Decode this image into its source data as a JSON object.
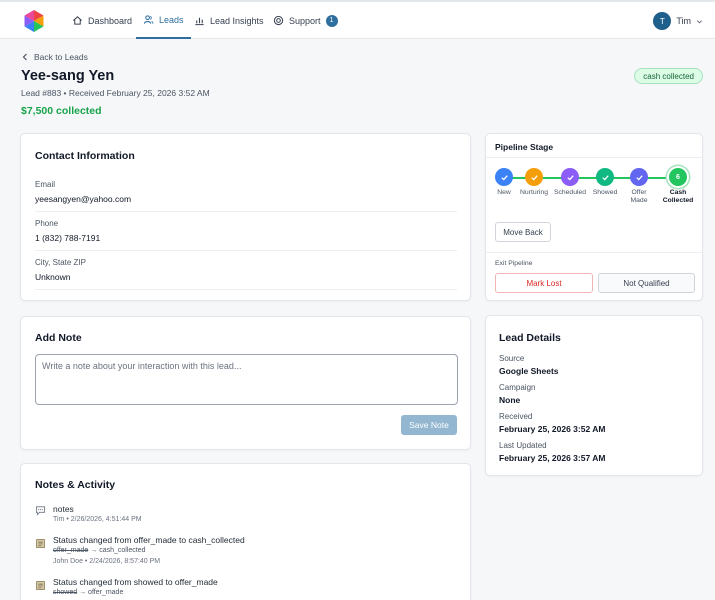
{
  "nav": {
    "items": [
      {
        "label": "Dashboard",
        "icon": "home-icon"
      },
      {
        "label": "Leads",
        "icon": "users-icon"
      },
      {
        "label": "Lead Insights",
        "icon": "chart-icon"
      },
      {
        "label": "Support",
        "icon": "support-icon",
        "badge": "1"
      }
    ],
    "active": "Leads",
    "user": {
      "initial": "T",
      "name": "Tim"
    }
  },
  "header": {
    "back_label": "Back to Leads",
    "name": "Yee-sang Yen",
    "meta": "Lead #883 • Received February 25, 2026 3:52 AM",
    "collected": "$7,500 collected",
    "status": "cash collected"
  },
  "contact": {
    "title": "Contact Information",
    "fields": [
      {
        "label": "Email",
        "value": "yeesangyen@yahoo.com"
      },
      {
        "label": "Phone",
        "value": "1 (832) 788-7191"
      },
      {
        "label": "City, State ZIP",
        "value": "Unknown"
      }
    ]
  },
  "note": {
    "title": "Add Note",
    "placeholder": "Write a note about your interaction with this lead...",
    "value": "",
    "save_label": "Save Note"
  },
  "activity": {
    "title": "Notes & Activity",
    "items": [
      {
        "icon": "comment-icon",
        "text": "notes",
        "by": "Tim • 2/26/2026, 4:51:44 PM"
      },
      {
        "icon": "note-icon",
        "text": "Status changed from offer_made to cash_collected",
        "old": "offer_made",
        "arrow": "→",
        "new": "cash_collected",
        "by": "John Doe • 2/24/2026, 8:57:40 PM"
      },
      {
        "icon": "note-icon",
        "text": "Status changed from showed to offer_made",
        "old": "showed",
        "arrow": "→",
        "new": "offer_made",
        "by": ""
      }
    ]
  },
  "pipeline": {
    "title": "Pipeline Stage",
    "stages": [
      {
        "label": "New",
        "color": "#3b82f6"
      },
      {
        "label": "Nurturing",
        "color": "#f59e0b"
      },
      {
        "label": "Scheduled",
        "color": "#8b5cf6"
      },
      {
        "label": "Showed",
        "color": "#10b981"
      },
      {
        "label": "Offer Made",
        "color": "#6366f1"
      },
      {
        "label": "Cash Collected",
        "color": "#22c55e",
        "number": "6"
      }
    ],
    "move_back_label": "Move Back",
    "exit_label": "Exit Pipeline",
    "mark_lost_label": "Mark Lost",
    "not_qualified_label": "Not Qualified"
  },
  "details": {
    "title": "Lead Details",
    "fields": [
      {
        "label": "Source",
        "value": "Google Sheets"
      },
      {
        "label": "Campaign",
        "value": "None"
      },
      {
        "label": "Received",
        "value": "February 25, 2026 3:52 AM"
      },
      {
        "label": "Last Updated",
        "value": "February 25, 2026 3:57 AM"
      }
    ]
  },
  "colors": {
    "accent": "#2f6f9f",
    "success": "#16a34a",
    "danger": "#dc2626"
  }
}
